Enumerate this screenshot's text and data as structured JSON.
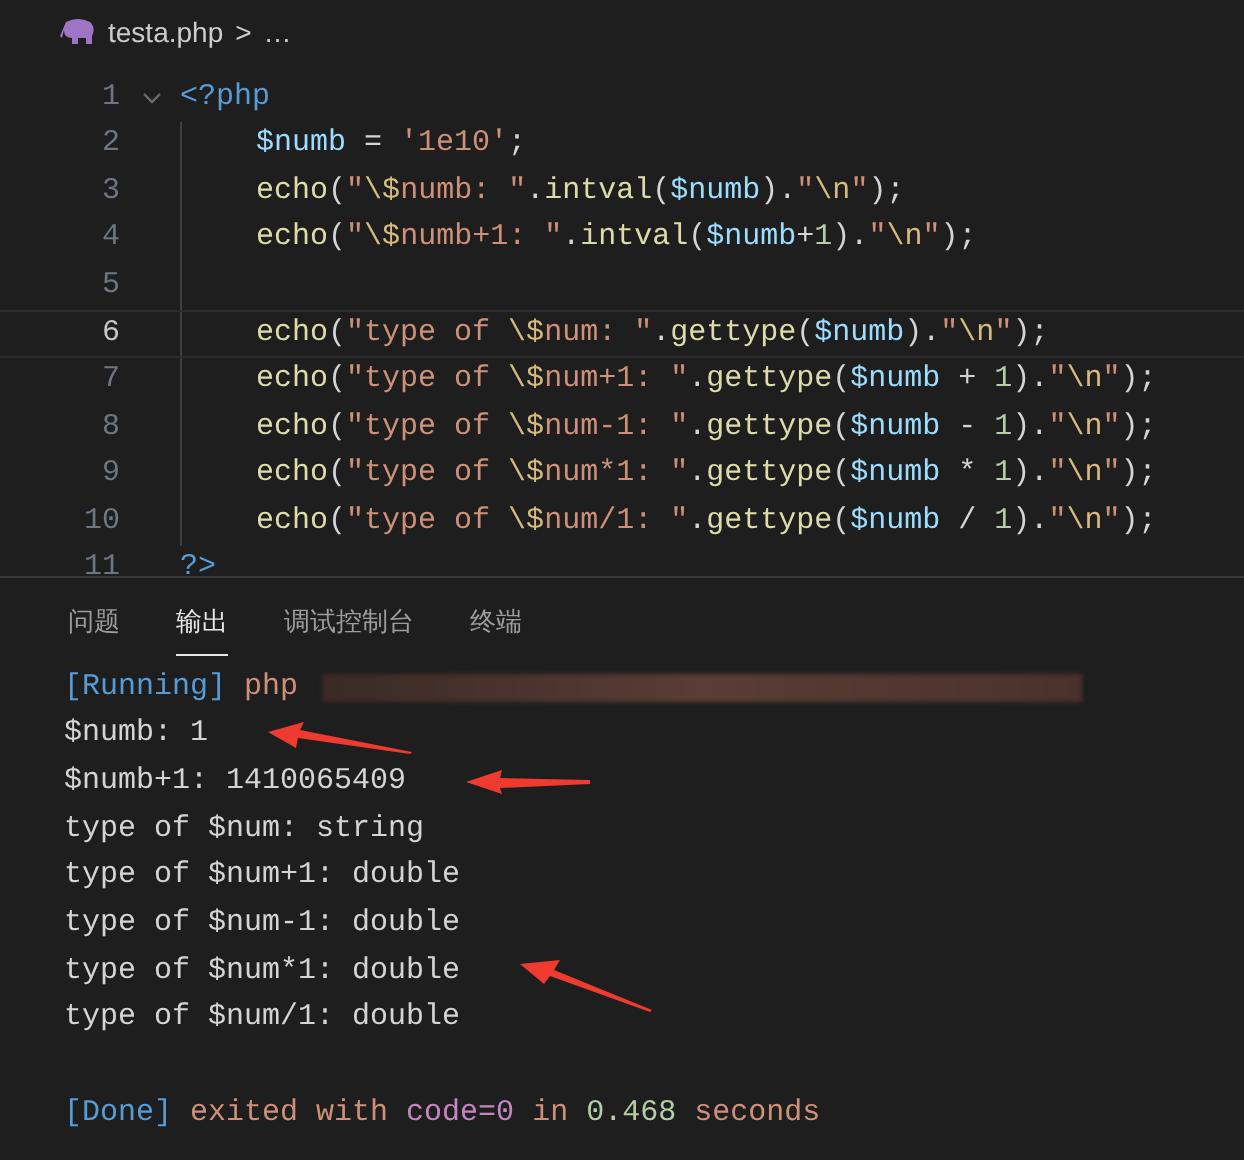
{
  "breadcrumb": {
    "file": "testa.php",
    "separator": ">",
    "more": "…"
  },
  "editor": {
    "lines": [
      {
        "number": "1",
        "expanded": true,
        "current": false,
        "tokens": [
          {
            "text": "<?php",
            "kind": "tag"
          }
        ],
        "children": [
          {
            "number": "2",
            "current": false,
            "tokens": [
              {
                "text": "$numb",
                "kind": "var"
              },
              {
                "text": " = ",
                "kind": "plain"
              },
              {
                "text": "'1e10'",
                "kind": "str"
              },
              {
                "text": ";",
                "kind": "plain"
              }
            ]
          },
          {
            "number": "3",
            "current": false,
            "tokens": [
              {
                "text": "echo",
                "kind": "fn"
              },
              {
                "text": "(",
                "kind": "plain"
              },
              {
                "text": "\"",
                "kind": "str"
              },
              {
                "text": "\\$",
                "kind": "esc"
              },
              {
                "text": "numb: \"",
                "kind": "str"
              },
              {
                "text": ".",
                "kind": "plain"
              },
              {
                "text": "intval",
                "kind": "fn"
              },
              {
                "text": "(",
                "kind": "plain"
              },
              {
                "text": "$numb",
                "kind": "var"
              },
              {
                "text": ").",
                "kind": "plain"
              },
              {
                "text": "\"",
                "kind": "str"
              },
              {
                "text": "\\n",
                "kind": "esc"
              },
              {
                "text": "\"",
                "kind": "str"
              },
              {
                "text": ");",
                "kind": "plain"
              }
            ]
          },
          {
            "number": "4",
            "current": false,
            "tokens": [
              {
                "text": "echo",
                "kind": "fn"
              },
              {
                "text": "(",
                "kind": "plain"
              },
              {
                "text": "\"",
                "kind": "str"
              },
              {
                "text": "\\$",
                "kind": "esc"
              },
              {
                "text": "numb+1: \"",
                "kind": "str"
              },
              {
                "text": ".",
                "kind": "plain"
              },
              {
                "text": "intval",
                "kind": "fn"
              },
              {
                "text": "(",
                "kind": "plain"
              },
              {
                "text": "$numb",
                "kind": "var"
              },
              {
                "text": "+",
                "kind": "plain"
              },
              {
                "text": "1",
                "kind": "num"
              },
              {
                "text": ").",
                "kind": "plain"
              },
              {
                "text": "\"",
                "kind": "str"
              },
              {
                "text": "\\n",
                "kind": "esc"
              },
              {
                "text": "\"",
                "kind": "str"
              },
              {
                "text": ");",
                "kind": "plain"
              }
            ]
          },
          {
            "number": "5",
            "current": false
          },
          {
            "number": "6",
            "current": true,
            "tokens": [
              {
                "text": "echo",
                "kind": "fn"
              },
              {
                "text": "(",
                "kind": "plain"
              },
              {
                "text": "\"type of ",
                "kind": "str"
              },
              {
                "text": "\\$",
                "kind": "esc"
              },
              {
                "text": "num: \"",
                "kind": "str"
              },
              {
                "text": ".",
                "kind": "plain"
              },
              {
                "text": "gettype",
                "kind": "fn"
              },
              {
                "text": "(",
                "kind": "plain"
              },
              {
                "text": "$numb",
                "kind": "var"
              },
              {
                "text": ").",
                "kind": "plain"
              },
              {
                "text": "\"",
                "kind": "str"
              },
              {
                "text": "\\n",
                "kind": "esc"
              },
              {
                "text": "\"",
                "kind": "str"
              },
              {
                "text": ");",
                "kind": "plain"
              }
            ]
          },
          {
            "number": "7",
            "current": false,
            "tokens": [
              {
                "text": "echo",
                "kind": "fn"
              },
              {
                "text": "(",
                "kind": "plain"
              },
              {
                "text": "\"type of ",
                "kind": "str"
              },
              {
                "text": "\\$",
                "kind": "esc"
              },
              {
                "text": "num+1: \"",
                "kind": "str"
              },
              {
                "text": ".",
                "kind": "plain"
              },
              {
                "text": "gettype",
                "kind": "fn"
              },
              {
                "text": "(",
                "kind": "plain"
              },
              {
                "text": "$numb",
                "kind": "var"
              },
              {
                "text": " + ",
                "kind": "plain"
              },
              {
                "text": "1",
                "kind": "num"
              },
              {
                "text": ").",
                "kind": "plain"
              },
              {
                "text": "\"",
                "kind": "str"
              },
              {
                "text": "\\n",
                "kind": "esc"
              },
              {
                "text": "\"",
                "kind": "str"
              },
              {
                "text": ");",
                "kind": "plain"
              }
            ]
          },
          {
            "number": "8",
            "current": false,
            "tokens": [
              {
                "text": "echo",
                "kind": "fn"
              },
              {
                "text": "(",
                "kind": "plain"
              },
              {
                "text": "\"type of ",
                "kind": "str"
              },
              {
                "text": "\\$",
                "kind": "esc"
              },
              {
                "text": "num-1: \"",
                "kind": "str"
              },
              {
                "text": ".",
                "kind": "plain"
              },
              {
                "text": "gettype",
                "kind": "fn"
              },
              {
                "text": "(",
                "kind": "plain"
              },
              {
                "text": "$numb",
                "kind": "var"
              },
              {
                "text": " - ",
                "kind": "plain"
              },
              {
                "text": "1",
                "kind": "num"
              },
              {
                "text": ").",
                "kind": "plain"
              },
              {
                "text": "\"",
                "kind": "str"
              },
              {
                "text": "\\n",
                "kind": "esc"
              },
              {
                "text": "\"",
                "kind": "str"
              },
              {
                "text": ");",
                "kind": "plain"
              }
            ]
          },
          {
            "number": "9",
            "current": false,
            "tokens": [
              {
                "text": "echo",
                "kind": "fn"
              },
              {
                "text": "(",
                "kind": "plain"
              },
              {
                "text": "\"type of ",
                "kind": "str"
              },
              {
                "text": "\\$",
                "kind": "esc"
              },
              {
                "text": "num*1: \"",
                "kind": "str"
              },
              {
                "text": ".",
                "kind": "plain"
              },
              {
                "text": "gettype",
                "kind": "fn"
              },
              {
                "text": "(",
                "kind": "plain"
              },
              {
                "text": "$numb",
                "kind": "var"
              },
              {
                "text": " * ",
                "kind": "plain"
              },
              {
                "text": "1",
                "kind": "num"
              },
              {
                "text": ").",
                "kind": "plain"
              },
              {
                "text": "\"",
                "kind": "str"
              },
              {
                "text": "\\n",
                "kind": "esc"
              },
              {
                "text": "\"",
                "kind": "str"
              },
              {
                "text": ");",
                "kind": "plain"
              }
            ]
          },
          {
            "number": "10",
            "current": false,
            "tokens": [
              {
                "text": "echo",
                "kind": "fn"
              },
              {
                "text": "(",
                "kind": "plain"
              },
              {
                "text": "\"type of ",
                "kind": "str"
              },
              {
                "text": "\\$",
                "kind": "esc"
              },
              {
                "text": "num/1: \"",
                "kind": "str"
              },
              {
                "text": ".",
                "kind": "plain"
              },
              {
                "text": "gettype",
                "kind": "fn"
              },
              {
                "text": "(",
                "kind": "plain"
              },
              {
                "text": "$numb",
                "kind": "var"
              },
              {
                "text": " / ",
                "kind": "plain"
              },
              {
                "text": "1",
                "kind": "num"
              },
              {
                "text": ").",
                "kind": "plain"
              },
              {
                "text": "\"",
                "kind": "str"
              },
              {
                "text": "\\n",
                "kind": "esc"
              },
              {
                "text": "\"",
                "kind": "str"
              },
              {
                "text": ");",
                "kind": "plain"
              }
            ]
          }
        ]
      },
      {
        "number": "11",
        "current": false,
        "tokens": [
          {
            "text": "?>",
            "kind": "tag"
          }
        ]
      }
    ]
  },
  "panel": {
    "tabs": [
      {
        "label": "问题",
        "selected": false
      },
      {
        "label": "输出",
        "selected": true
      },
      {
        "label": "调试控制台",
        "selected": false
      },
      {
        "label": "终端",
        "selected": false
      }
    ],
    "output": [
      {
        "arrow": false,
        "blurred": true,
        "tokens": [
          {
            "text": "[Running]",
            "kind": "tag"
          },
          {
            "text": " php",
            "kind": "str"
          }
        ]
      },
      {
        "arrow": true,
        "blurred": false,
        "tokens": [
          {
            "text": "$numb: 1",
            "kind": "plain"
          }
        ]
      },
      {
        "arrow": true,
        "blurred": false,
        "tokens": [
          {
            "text": "$numb+1: 1410065409",
            "kind": "plain"
          }
        ]
      },
      {
        "arrow": false,
        "blurred": false,
        "tokens": [
          {
            "text": "type of $num: string",
            "kind": "plain"
          }
        ]
      },
      {
        "arrow": false,
        "blurred": false,
        "tokens": [
          {
            "text": "type of $num+1: double",
            "kind": "plain"
          }
        ]
      },
      {
        "arrow": false,
        "blurred": false,
        "tokens": [
          {
            "text": "type of $num-1: double",
            "kind": "plain"
          }
        ]
      },
      {
        "arrow": true,
        "blurred": false,
        "tokens": [
          {
            "text": "type of $num*1: double",
            "kind": "plain"
          }
        ]
      },
      {
        "arrow": false,
        "blurred": false,
        "tokens": [
          {
            "text": "type of $num/1: double",
            "kind": "plain"
          }
        ]
      },
      {
        "arrow": false,
        "blurred": false
      },
      {
        "arrow": false,
        "blurred": false,
        "tokens": [
          {
            "text": "[Done]",
            "kind": "tag"
          },
          {
            "text": " exited with ",
            "kind": "str"
          },
          {
            "text": "code=0",
            "kind": "kw"
          },
          {
            "text": " in ",
            "kind": "str"
          },
          {
            "text": "0.468",
            "kind": "num"
          },
          {
            "text": " seconds",
            "kind": "str"
          }
        ]
      }
    ]
  }
}
